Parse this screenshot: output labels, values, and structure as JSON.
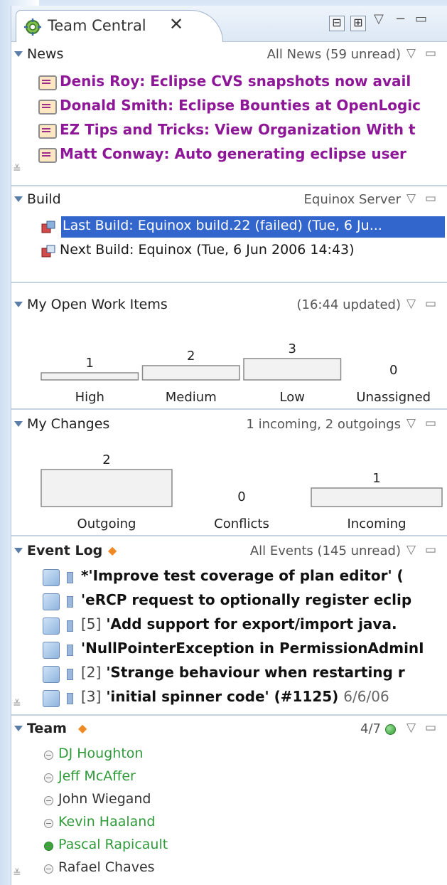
{
  "tab": {
    "title": "Team Central",
    "close_glyph": "✕",
    "minimize_glyph": "−",
    "maximize_glyph": "▭",
    "menu_glyph": "▽",
    "collapse_glyph": "⊟",
    "expand_glyph": "⊞"
  },
  "news": {
    "title": "News",
    "info": "All News (59 unread)",
    "items": [
      "Denis Roy: Eclipse CVS snapshots now avail",
      "Donald Smith: Eclipse Bounties at OpenLogic",
      "EZ Tips and Tricks: View Organization With t",
      "Matt Conway: Auto generating eclipse user"
    ]
  },
  "build": {
    "title": "Build",
    "info": "Equinox Server",
    "items": [
      "Last Build: Equinox build.22 (failed) (Tue, 6 Ju...",
      "Next Build: Equinox (Tue, 6 Jun 2006 14:43)"
    ]
  },
  "work_items": {
    "title": "My Open Work Items",
    "info": "(16:44 updated)"
  },
  "changes": {
    "title": "My Changes",
    "info": "1 incoming, 2 outgoings"
  },
  "event_log": {
    "title": "Event Log",
    "info": "All Events (145 unread)",
    "items": [
      {
        "num": "",
        "text": "*'Improve test coverage of plan editor' (",
        "date": ""
      },
      {
        "num": "",
        "text": "'eRCP request to optionally register eclip",
        "date": ""
      },
      {
        "num": "[5]",
        "text": "'Add support for export/import java.",
        "date": ""
      },
      {
        "num": "",
        "text": "'NullPointerException in PermissionAdminI",
        "date": ""
      },
      {
        "num": "[2]",
        "text": "'Strange behaviour when restarting r",
        "date": ""
      },
      {
        "num": "[3]",
        "text": "'initial spinner code' (#1125)",
        "date": "6/6/06"
      }
    ]
  },
  "team": {
    "title": "Team",
    "info": "4/7",
    "members": [
      {
        "name": "DJ Houghton",
        "color": "#2f9a3a",
        "online": false
      },
      {
        "name": "Jeff McAffer",
        "color": "#2f9a3a",
        "online": false
      },
      {
        "name": "John Wiegand",
        "color": "#333333",
        "online": false
      },
      {
        "name": "Kevin Haaland",
        "color": "#2f9a3a",
        "online": false
      },
      {
        "name": "Pascal Rapicault",
        "color": "#2f9a3a",
        "online": true
      },
      {
        "name": "Rafael Chaves",
        "color": "#333333",
        "online": false
      }
    ]
  },
  "chart_data": [
    {
      "type": "bar",
      "categories": [
        "High",
        "Medium",
        "Low",
        "Unassigned"
      ],
      "values": [
        1,
        2,
        3,
        0
      ]
    },
    {
      "type": "bar",
      "categories": [
        "Outgoing",
        "Conflicts",
        "Incoming"
      ],
      "values": [
        2,
        0,
        1
      ]
    }
  ]
}
